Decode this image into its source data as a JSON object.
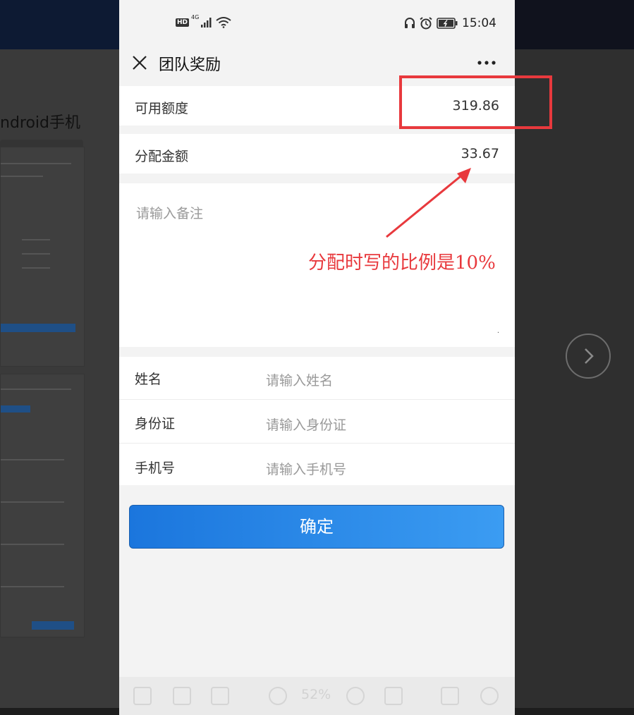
{
  "background": {
    "title_fragment": "ndroid手机"
  },
  "statusbar": {
    "hd_label": "HD",
    "network_label": "4G",
    "time": "15:04",
    "icons": [
      "signal-icon",
      "wifi-icon",
      "headset-icon",
      "alarm-icon",
      "battery-icon"
    ]
  },
  "navbar": {
    "title": "团队奖励"
  },
  "fields": {
    "available": {
      "label": "可用额度",
      "value": "319.86"
    },
    "allocation": {
      "label": "分配金额",
      "value": "33.67"
    },
    "remark": {
      "placeholder": "请输入备注"
    },
    "name": {
      "label": "姓名",
      "placeholder": "请输入姓名"
    },
    "id_card": {
      "label": "身份证",
      "placeholder": "请输入身份证"
    },
    "phone": {
      "label": "手机号",
      "placeholder": "请输入手机号"
    }
  },
  "confirm_button": {
    "label": "确定"
  },
  "annotation": {
    "text": "分配时写的比例是10%",
    "color": "#e8393d"
  },
  "viewer_toolbar": {
    "zoom": "52%",
    "icons": [
      "save-icon",
      "rotate-icon",
      "share-icon",
      "zoom-out-icon",
      "zoom-in-icon",
      "actual-size-icon",
      "fullscreen-icon",
      "refresh-icon"
    ]
  },
  "colors": {
    "accent": "#1b76dd",
    "annotation": "#e8393d"
  }
}
